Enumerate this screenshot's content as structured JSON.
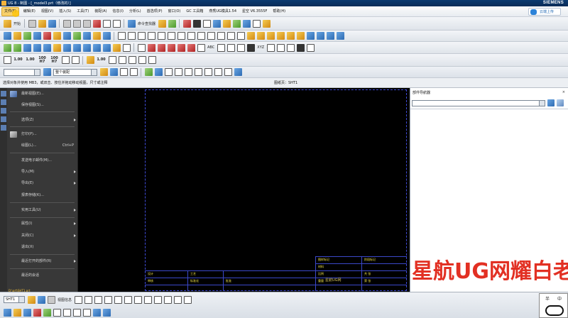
{
  "titlebar": {
    "title": "UG 8 - 制图 - [_model3.prt（修改的）]",
    "brand": "SIEMENS"
  },
  "menubar": {
    "items": [
      "文件(F)",
      "编辑(E)",
      "视图(V)",
      "插入(S)",
      "工具(T)",
      "装配(A)",
      "信息(I)",
      "分析(L)",
      "首选项(P)",
      "窗口(O)",
      "GC 工具箱",
      "燕秀UG模具1.54",
      "星空 V6.3555F",
      "帮助(H)"
    ],
    "cloud_button": "云端上传"
  },
  "toolbar": {
    "start_label": "开始",
    "command_finder": "命令查找器",
    "select_filter": "整个装配",
    "numbers": [
      "1.00",
      "1.00",
      "100 H7",
      "100 H7",
      "1.00"
    ],
    "text_labels": [
      "ABC",
      "XYZ"
    ]
  },
  "status": {
    "prompt": "选择对象并使用 MB3，或双击、按住并拖动移动视图，尺寸或注释",
    "sheet": "图纸页：SHT1"
  },
  "file_menu": {
    "items": [
      {
        "label": "最新视图(E)...",
        "submenu": false
      },
      {
        "label": "保存视图(S)...",
        "submenu": false
      },
      {
        "label": "选项(Z)",
        "submenu": true
      },
      {
        "label": "打印(P)...",
        "submenu": false
      },
      {
        "label": "绘图(L)...",
        "shortcut": "Ctrl+P"
      },
      {
        "label": "发送电子邮件(M)...",
        "submenu": false
      },
      {
        "label": "导入(M)",
        "submenu": true
      },
      {
        "label": "导出(E)",
        "submenu": true
      },
      {
        "label": "报表存储(K)...",
        "submenu": false
      },
      {
        "label": "实用工具(U)",
        "submenu": true
      },
      {
        "label": "属性(I)",
        "submenu": true
      },
      {
        "label": "关闭(C)",
        "submenu": true
      },
      {
        "label": "退出(X)",
        "submenu": false
      },
      {
        "label": "最近打开的部件(R)",
        "submenu": true
      },
      {
        "label": "最近的会话",
        "submenu": false
      }
    ],
    "recent_file": "D:\\prt\\SHT1.prt"
  },
  "drawing": {
    "title_block_cells": [
      "设计",
      "审核",
      "工艺",
      "标准化",
      "批准",
      "比例",
      "重量",
      "共 张",
      "第 张",
      "图样标记",
      "材料",
      "阶段标记"
    ],
    "logo_text": "星航UG网"
  },
  "right_panel": {
    "title": "部件导航器",
    "close": "×"
  },
  "watermark": "星航UG网耀白老师",
  "bottom": {
    "sheet_select": "SHT1",
    "left_label": "视图信息"
  },
  "ime": {
    "half": "半",
    "mid": "中"
  }
}
